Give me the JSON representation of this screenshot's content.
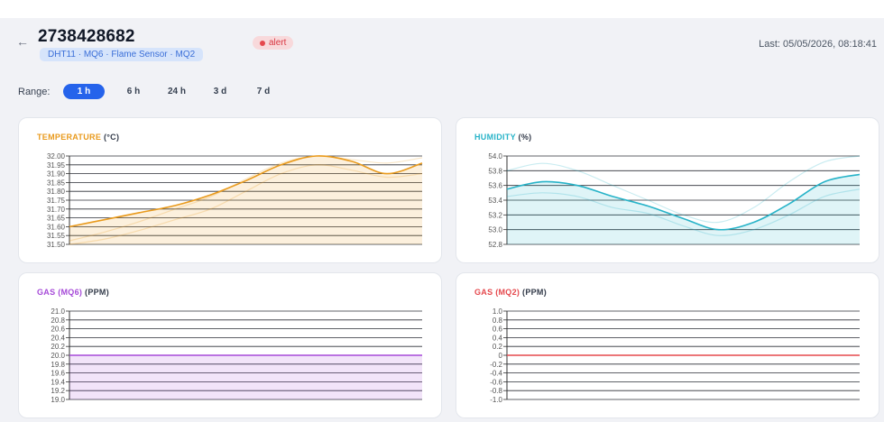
{
  "header": {
    "back_icon": "←",
    "device_id": "2738428682",
    "sensors": "DHT11 · MQ6 · Flame Sensor · MQ2",
    "status": "alert",
    "last_updated": "Last: 05/05/2026, 08:18:41"
  },
  "range": {
    "label": "Range:",
    "options": [
      "1 h",
      "6 h",
      "24 h",
      "3 d",
      "7 d"
    ],
    "selected": "1 h"
  },
  "colors": {
    "accent": "#2563eb",
    "temperature": "#e99a1c",
    "humidity": "#27b3c8",
    "gas_mq6": "#a64ad8",
    "gas_mq2": "#e5484d",
    "alert": "#e5484d"
  },
  "chart_data": [
    {
      "id": "temperature",
      "type": "area",
      "title": "TEMPERATURE",
      "unit": "(°C)",
      "ylim": [
        31.5,
        32.0
      ],
      "yticks": [
        "32.00",
        "31.95",
        "31.90",
        "31.85",
        "31.80",
        "31.75",
        "31.70",
        "31.65",
        "31.60",
        "31.55",
        "31.50"
      ],
      "x": [
        0,
        0.1,
        0.2,
        0.3,
        0.4,
        0.5,
        0.6,
        0.7,
        0.8,
        0.9,
        1.0
      ],
      "series": [
        {
          "values": [
            31.6,
            31.64,
            31.68,
            31.72,
            31.78,
            31.86,
            31.95,
            32.0,
            31.97,
            31.9,
            31.96
          ]
        }
      ],
      "band_upper": [
        31.52,
        31.57,
        31.63,
        31.7,
        31.77,
        31.87,
        31.96,
        32.0,
        31.98,
        31.96,
        31.99
      ],
      "band_lower": [
        31.5,
        31.53,
        31.58,
        31.64,
        31.7,
        31.8,
        31.9,
        31.95,
        31.92,
        31.88,
        31.9
      ],
      "grid": true
    },
    {
      "id": "humidity",
      "type": "area",
      "title": "HUMIDITY",
      "unit": "(%)",
      "ylim": [
        52.8,
        54.0
      ],
      "yticks": [
        "54.0",
        "53.8",
        "53.6",
        "53.4",
        "53.2",
        "53.0",
        "52.8"
      ],
      "x": [
        0,
        0.1,
        0.2,
        0.3,
        0.4,
        0.5,
        0.6,
        0.7,
        0.8,
        0.9,
        1.0
      ],
      "series": [
        {
          "values": [
            53.55,
            53.65,
            53.6,
            53.45,
            53.32,
            53.15,
            53.0,
            53.1,
            53.35,
            53.65,
            53.75
          ]
        }
      ],
      "band_upper": [
        53.8,
        53.9,
        53.8,
        53.6,
        53.4,
        53.2,
        53.1,
        53.3,
        53.65,
        53.92,
        54.0
      ],
      "band_lower": [
        53.45,
        53.5,
        53.45,
        53.3,
        53.22,
        53.05,
        52.92,
        53.0,
        53.2,
        53.45,
        53.55
      ],
      "grid": true
    },
    {
      "id": "gas-mq6",
      "type": "area",
      "title": "GAS (MQ6)",
      "unit": "(PPM)",
      "ylim": [
        19.0,
        21.0
      ],
      "yticks": [
        "21.0",
        "20.8",
        "20.6",
        "20.4",
        "20.2",
        "20.0",
        "19.8",
        "19.6",
        "19.4",
        "19.2",
        "19.0"
      ],
      "x": [
        0,
        1
      ],
      "series": [
        {
          "values": [
            20.0,
            20.0
          ]
        }
      ],
      "grid": true
    },
    {
      "id": "gas-mq2",
      "type": "line",
      "title": "GAS (MQ2)",
      "unit": "(PPM)",
      "ylim": [
        -1.0,
        1.0
      ],
      "yticks": [
        "1.0",
        "0.8",
        "0.6",
        "0.4",
        "0.2",
        "0",
        "-0.2",
        "-0.4",
        "-0.6",
        "-0.8",
        "-1.0"
      ],
      "x": [
        0,
        1
      ],
      "series": [
        {
          "values": [
            0,
            0
          ]
        }
      ],
      "grid": true
    }
  ]
}
